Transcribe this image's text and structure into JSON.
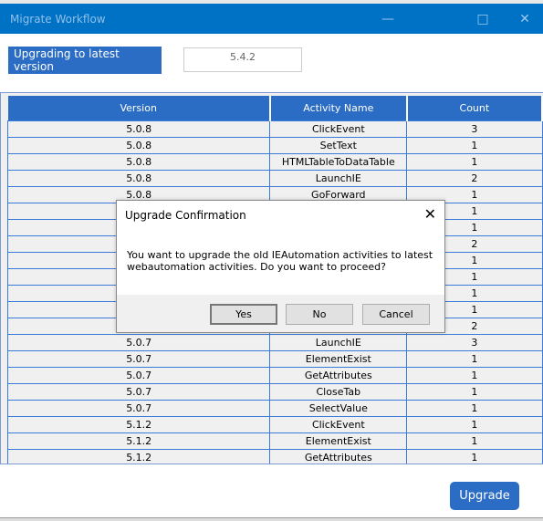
{
  "window": {
    "title": "Migrate Workflow",
    "minimize_icon": "minimize-icon",
    "maximize_icon": "maximize-icon",
    "close_icon": "close-icon"
  },
  "header": {
    "label": "Upgrading to latest version",
    "version": "5.4.2"
  },
  "table": {
    "columns": [
      "Version",
      "Activity Name",
      "Count"
    ],
    "rows": [
      [
        "5.0.8",
        "ClickEvent",
        "3"
      ],
      [
        "5.0.8",
        "SetText",
        "1"
      ],
      [
        "5.0.8",
        "HTMLTableToDataTable",
        "1"
      ],
      [
        "5.0.8",
        "LaunchIE",
        "2"
      ],
      [
        "5.0.8",
        "GoForward",
        "1"
      ],
      [
        "",
        "",
        "1"
      ],
      [
        "",
        "",
        "1"
      ],
      [
        "",
        "",
        "2"
      ],
      [
        "",
        "",
        "1"
      ],
      [
        "",
        "",
        "1"
      ],
      [
        "",
        "",
        "1"
      ],
      [
        "",
        "",
        "1"
      ],
      [
        "",
        "",
        "2"
      ],
      [
        "5.0.7",
        "LaunchIE",
        "3"
      ],
      [
        "5.0.7",
        "ElementExist",
        "1"
      ],
      [
        "5.0.7",
        "GetAttributes",
        "1"
      ],
      [
        "5.0.7",
        "CloseTab",
        "1"
      ],
      [
        "5.0.7",
        "SelectValue",
        "1"
      ],
      [
        "5.1.2",
        "ClickEvent",
        "1"
      ],
      [
        "5.1.2",
        "ElementExist",
        "1"
      ],
      [
        "5.1.2",
        "GetAttributes",
        "1"
      ]
    ]
  },
  "upgrade_button": "Upgrade",
  "dialog": {
    "title": "Upgrade Confirmation",
    "message": "You want to upgrade the old IEAutomation activities to latest webautomation activities. Do you want to proceed?",
    "yes": "Yes",
    "no": "No",
    "cancel": "Cancel"
  },
  "colors": {
    "titlebar": "#0072c6",
    "accent": "#2b6cc4"
  }
}
